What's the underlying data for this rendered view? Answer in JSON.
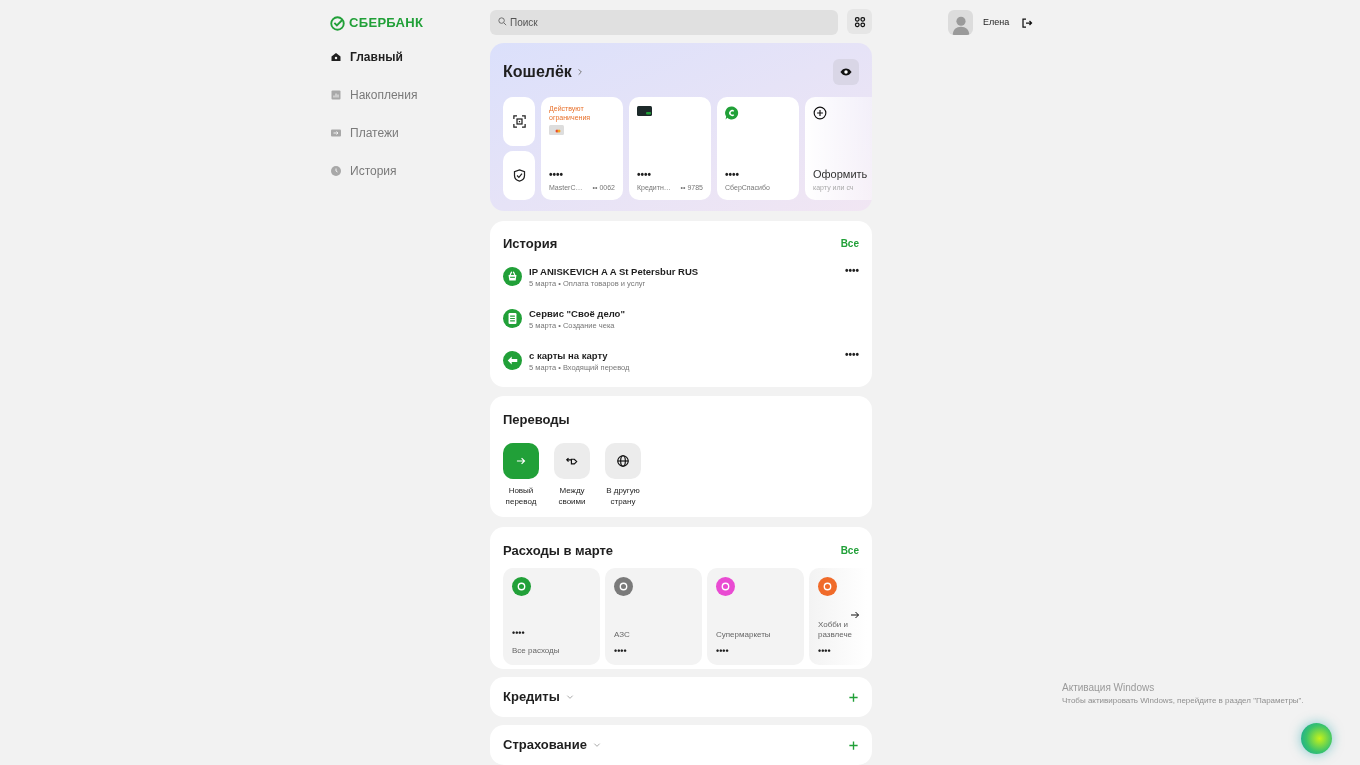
{
  "header": {
    "logo": "СБЕРБАНК",
    "search": {
      "placeholder": "Поиск"
    },
    "user": "Елена"
  },
  "sidebar": {
    "items": [
      {
        "label": "Главный",
        "selected": true
      },
      {
        "label": "Накопления",
        "selected": false
      },
      {
        "label": "Платежи",
        "selected": false
      },
      {
        "label": "История",
        "selected": false
      }
    ]
  },
  "wallet": {
    "title": "Кошелёк",
    "cards": [
      {
        "kind": "card",
        "notice": "Действуют ограничения",
        "amount": "••••",
        "name": "MasterC…",
        "number": "•• 0062"
      },
      {
        "kind": "card",
        "amount": "••••",
        "name": "Кредитн…",
        "number": "•• 9785"
      },
      {
        "kind": "bonus",
        "amount": "••••",
        "name": "СберСпасибо"
      },
      {
        "kind": "add",
        "title": "Оформить",
        "subtitle": "карту или сч"
      }
    ]
  },
  "history": {
    "title": "История",
    "all_link": "Все",
    "items": [
      {
        "kind": "purchase",
        "title": "IP ANISKEVICH A A St Petersbur RUS",
        "subtitle": "5 марта • Оплата товаров и услуг",
        "menu": "••••"
      },
      {
        "kind": "receipt",
        "title": "Сервис \"Своё дело\"",
        "subtitle": "5 марта • Создание чека"
      },
      {
        "kind": "incoming",
        "title": "с карты на карту",
        "subtitle": "5 марта • Входящий перевод",
        "menu": "••••"
      }
    ]
  },
  "transfers": {
    "title": "Переводы",
    "items": [
      {
        "kind": "primary",
        "label": "Новый перевод"
      },
      {
        "kind": "secondary",
        "label": "Между своими"
      },
      {
        "kind": "secondary",
        "label": "В другую страну"
      }
    ]
  },
  "expenses": {
    "title": "Расходы в марте",
    "all_link": "Все",
    "items": [
      {
        "kind": "total",
        "color": "#21a038",
        "amount": "••••",
        "label": "Все расходы"
      },
      {
        "kind": "category",
        "color": "#7a7a7a",
        "amount": "••••",
        "label": "АЗС"
      },
      {
        "kind": "category",
        "color": "#e94bd2",
        "amount": "••••",
        "label": "Супермаркеты"
      },
      {
        "kind": "category",
        "color": "#f06b2a",
        "amount": "••••",
        "label": "Хобби и развлече"
      }
    ]
  },
  "collapsed_sections": [
    {
      "title": "Кредиты"
    },
    {
      "title": "Страхование"
    }
  ],
  "os_notice": {
    "title": "Активация Windows",
    "text": "Чтобы активировать Windows, перейдите в раздел \"Параметры\"."
  }
}
